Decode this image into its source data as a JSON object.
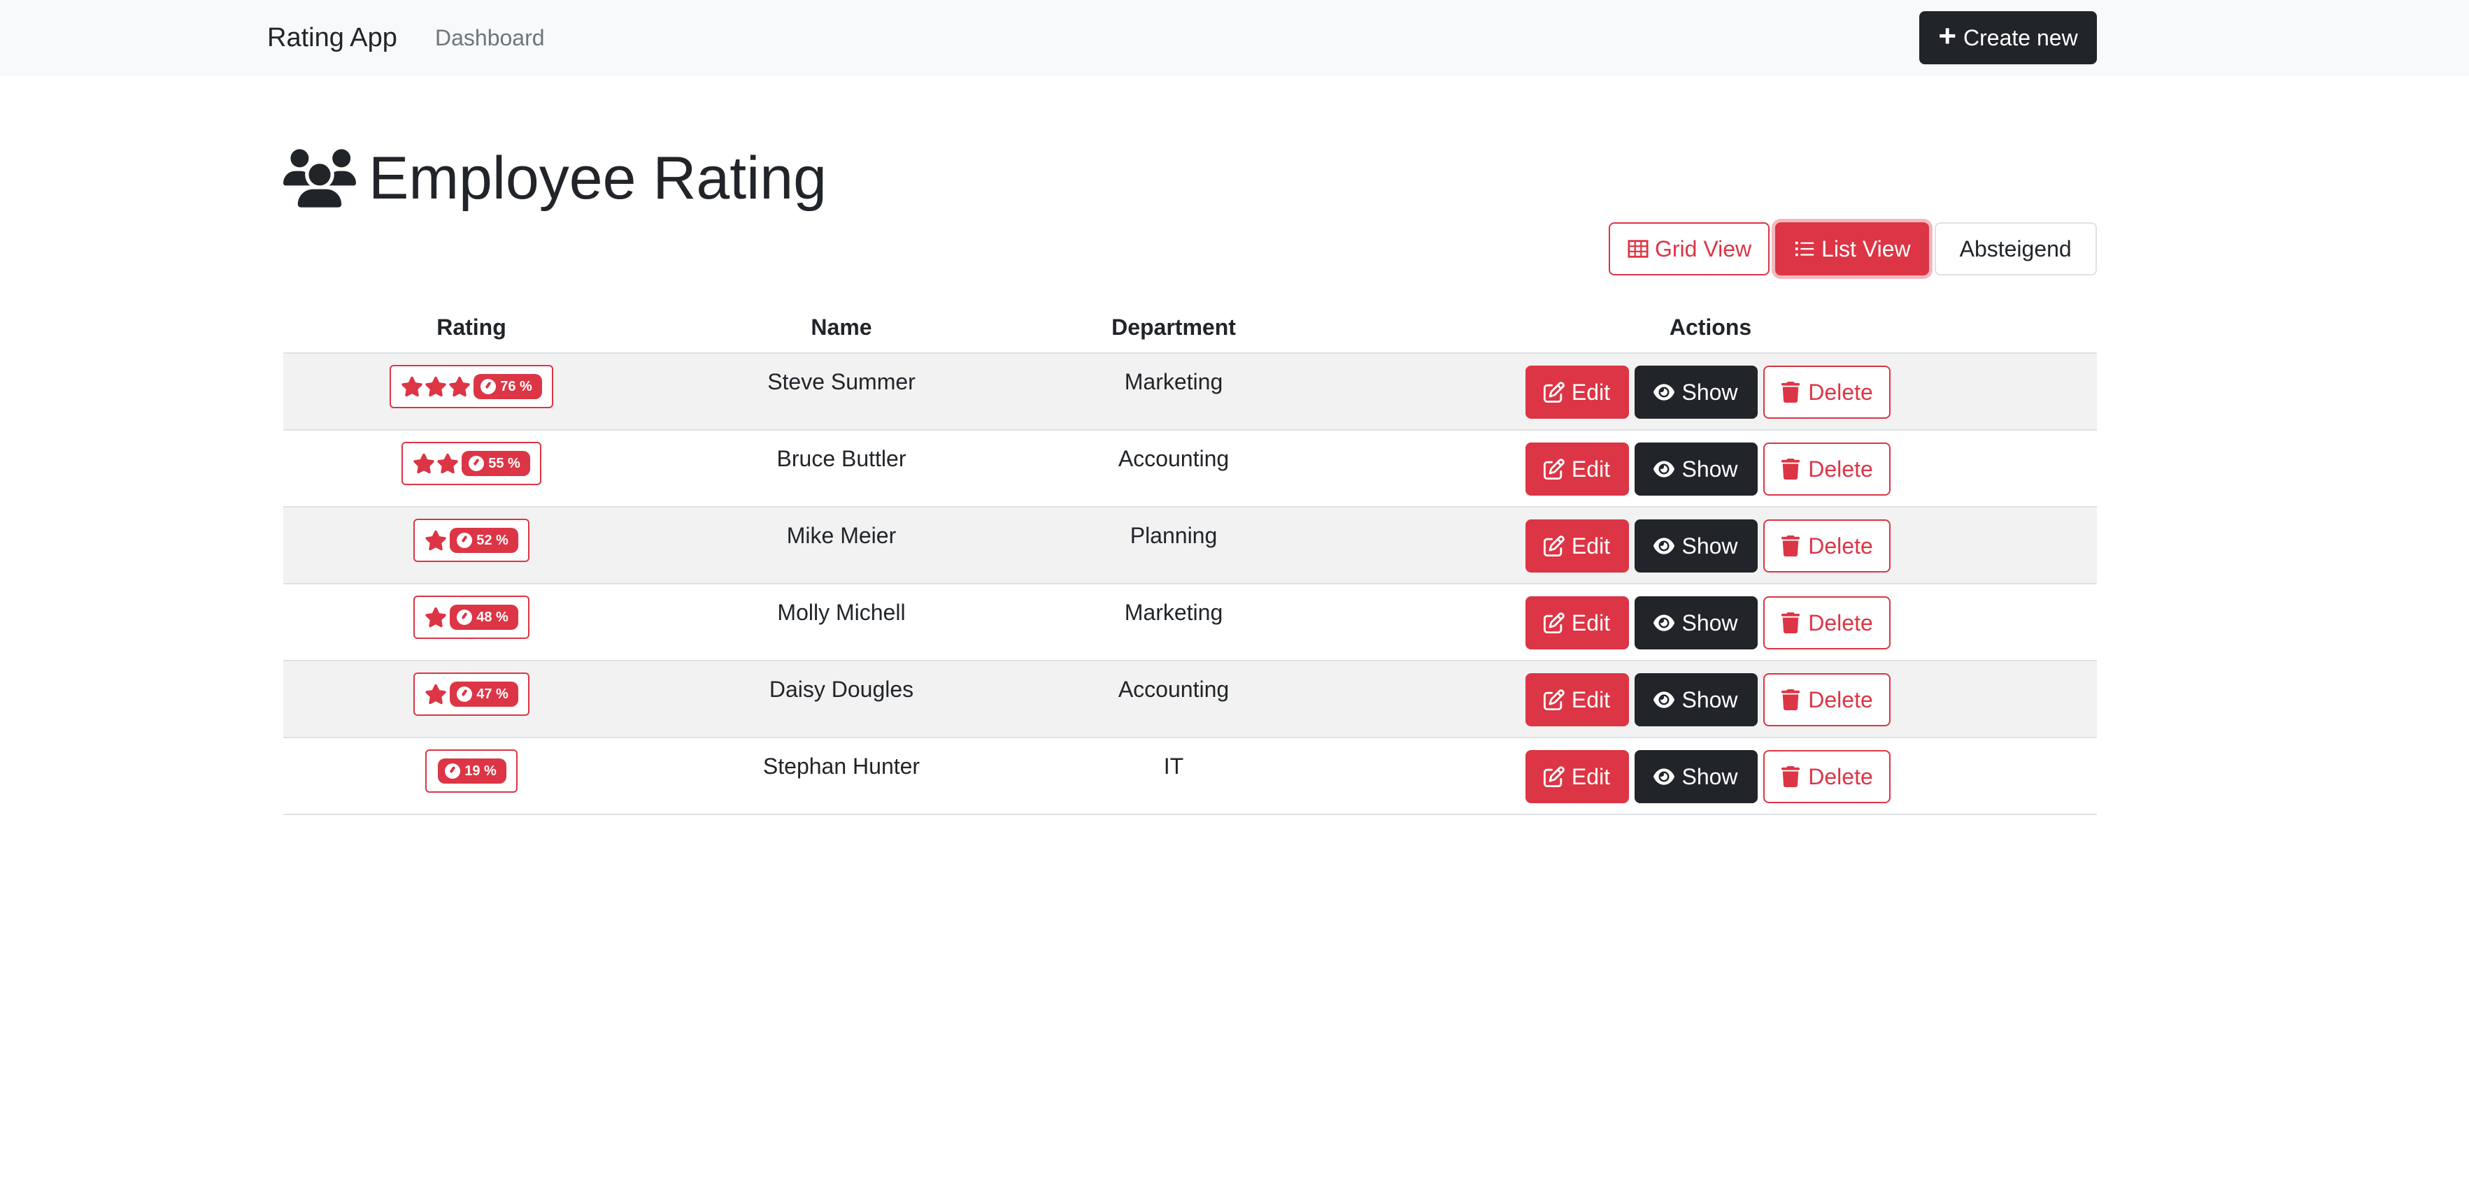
{
  "navbar": {
    "brand": "Rating App",
    "link_dashboard": "Dashboard",
    "create_label": "Create new"
  },
  "page": {
    "title": "Employee Rating",
    "title_icon": "users-icon"
  },
  "controls": {
    "grid_view_label": "Grid View",
    "list_view_label": "List View",
    "sort_label": "Absteigend",
    "active_view": "List View"
  },
  "table": {
    "headers": {
      "rating": "Rating",
      "name": "Name",
      "department": "Department",
      "actions": "Actions"
    },
    "rows": [
      {
        "stars": 3,
        "percent_label": "76 %",
        "name": "Steve Summer",
        "department": "Marketing"
      },
      {
        "stars": 2,
        "percent_label": "55 %",
        "name": "Bruce Buttler",
        "department": "Accounting"
      },
      {
        "stars": 1,
        "percent_label": "52 %",
        "name": "Mike Meier",
        "department": "Planning"
      },
      {
        "stars": 1,
        "percent_label": "48 %",
        "name": "Molly Michell",
        "department": "Marketing"
      },
      {
        "stars": 1,
        "percent_label": "47 %",
        "name": "Daisy Dougles",
        "department": "Accounting"
      },
      {
        "stars": 0,
        "percent_label": "19 %",
        "name": "Stephan Hunter",
        "department": "IT"
      }
    ],
    "actions": {
      "edit_label": "Edit",
      "show_label": "Show",
      "delete_label": "Delete"
    }
  },
  "colors": {
    "accent": "#dc3545",
    "dark": "#212529",
    "navbar_bg": "#f8f9fa",
    "stripe": "#f2f2f2"
  }
}
